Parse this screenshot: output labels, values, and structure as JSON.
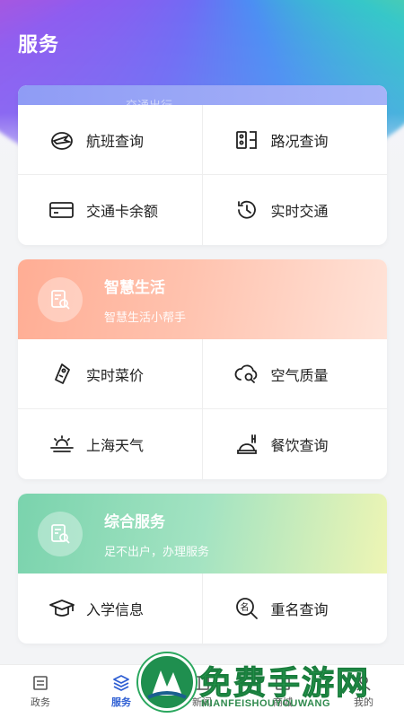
{
  "header": {
    "title": "服务"
  },
  "traffic_card": {
    "strip_text": "交通出行",
    "items": [
      {
        "label": "航班查询",
        "icon": "plane-icon"
      },
      {
        "label": "路况查询",
        "icon": "road-icon"
      },
      {
        "label": "交通卡余额",
        "icon": "card-icon"
      },
      {
        "label": "实时交通",
        "icon": "history-icon"
      }
    ]
  },
  "life_card": {
    "title": "智慧生活",
    "subtitle": "智慧生活小帮手",
    "items": [
      {
        "label": "实时菜价",
        "icon": "price-tag-icon"
      },
      {
        "label": "空气质量",
        "icon": "cloud-search-icon"
      },
      {
        "label": "上海天气",
        "icon": "weather-icon"
      },
      {
        "label": "餐饮查询",
        "icon": "dining-icon"
      }
    ]
  },
  "service_card": {
    "title": "综合服务",
    "subtitle": "足不出户，办理服务",
    "items": [
      {
        "label": "入学信息",
        "icon": "graduation-cap-icon"
      },
      {
        "label": "重名查询",
        "icon": "name-search-icon"
      }
    ]
  },
  "tabbar": {
    "tabs": [
      {
        "label": "政务",
        "icon": "government-icon"
      },
      {
        "label": "服务",
        "icon": "layers-icon"
      },
      {
        "label": "新闻",
        "icon": "news-icon"
      },
      {
        "label": "商城",
        "icon": "shop-icon"
      },
      {
        "label": "我的",
        "icon": "user-icon"
      }
    ],
    "active": "服务"
  },
  "watermark": {
    "title": "免费手游网",
    "subtitle": "MIANFEISHOUYOUWANG"
  },
  "colors": {
    "accent": "#2f5fd3",
    "life": "#ffad94",
    "service": "#7ad3ad",
    "watermark": "#27a954"
  }
}
